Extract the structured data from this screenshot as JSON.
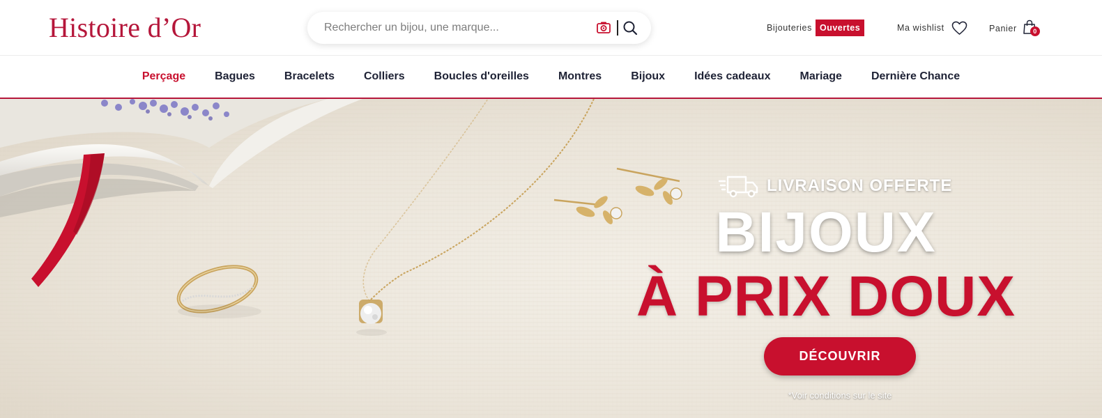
{
  "brand": {
    "logo_text": "Histoire d’Or",
    "accent_color": "#c8102e"
  },
  "search": {
    "placeholder": "Rechercher un bijou, une marque...",
    "camera_icon": "camera-icon",
    "search_icon": "search-icon"
  },
  "header": {
    "stores_label": "Bijouteries",
    "stores_badge": "Ouvertes",
    "wishlist_label": "Ma wishlist",
    "wishlist_icon": "heart-icon",
    "cart_label": "Panier",
    "cart_icon": "bag-icon",
    "cart_count": "0"
  },
  "nav": {
    "items": [
      {
        "label": "Perçage",
        "active": true
      },
      {
        "label": "Bagues"
      },
      {
        "label": "Bracelets"
      },
      {
        "label": "Colliers"
      },
      {
        "label": "Boucles d'oreilles"
      },
      {
        "label": "Montres"
      },
      {
        "label": "Bijoux"
      },
      {
        "label": "Idées cadeaux"
      },
      {
        "label": "Mariage"
      },
      {
        "label": "Dernière Chance"
      }
    ]
  },
  "hero": {
    "delivery_icon": "truck-icon",
    "delivery_text": "LIVRAISON OFFERTE",
    "headline_line1": "BIJOUX",
    "headline_line2": "À PRIX DOUX",
    "cta_label": "DÉCOUVRIR",
    "conditions": "*Voir conditions sur le site"
  }
}
